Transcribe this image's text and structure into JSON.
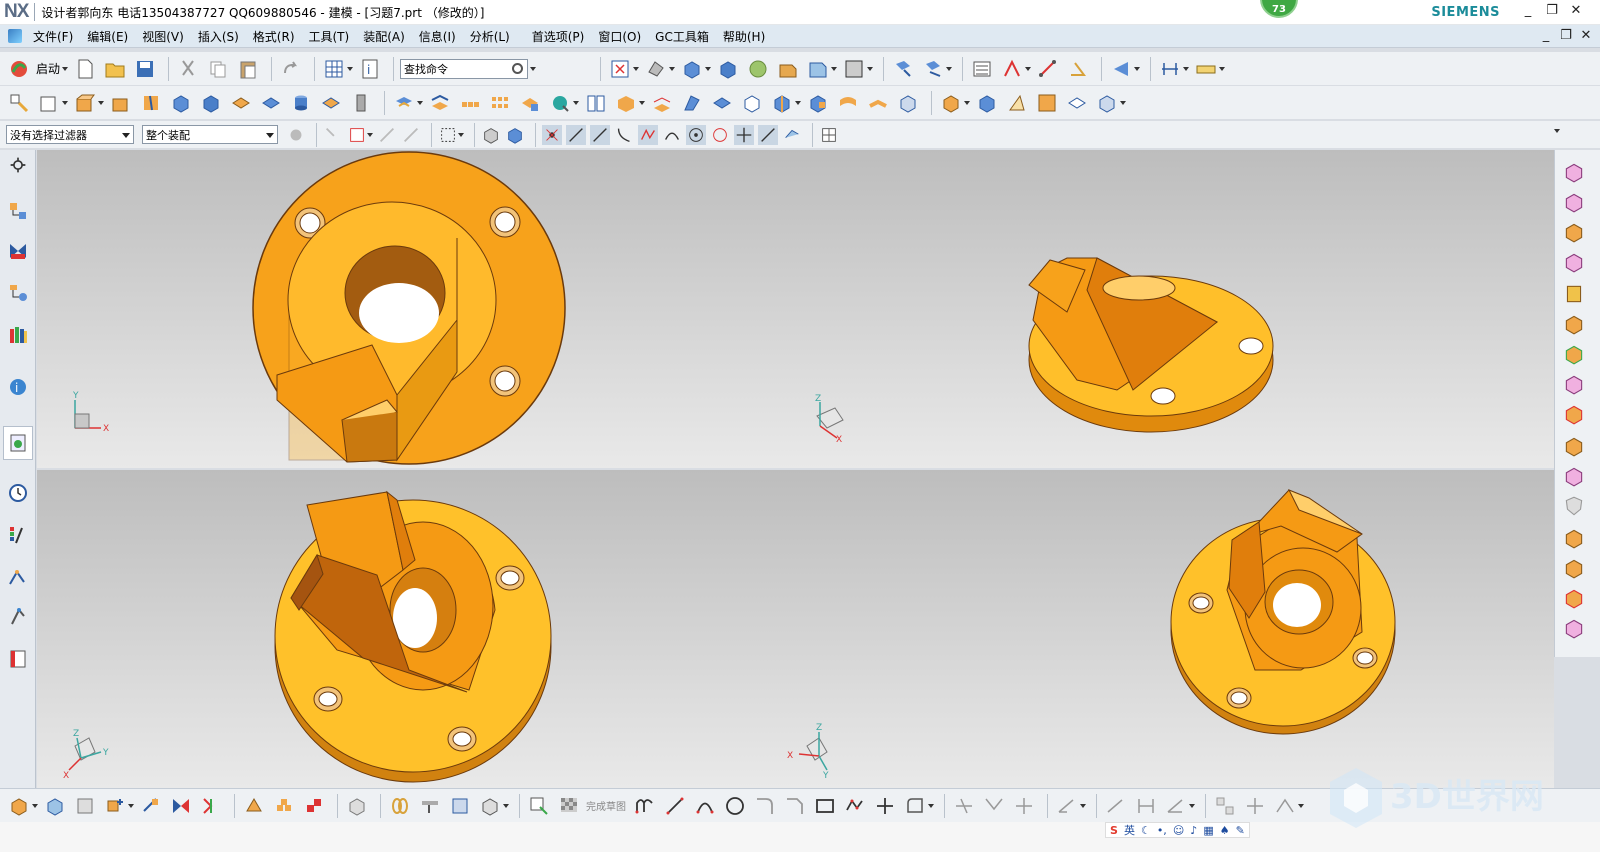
{
  "titlebar": {
    "logo": "NX",
    "title": "设计者郭向东  电话13504387727  QQ609880546 - 建模 - [习题7.prt （修改的）]",
    "brand": "SIEMENS",
    "badge": "73",
    "minimize": "_",
    "restore": "❐",
    "close": "✕"
  },
  "menubar": {
    "items": [
      "文件(F)",
      "编辑(E)",
      "视图(V)",
      "插入(S)",
      "格式(R)",
      "工具(T)",
      "装配(A)",
      "信息(I)",
      "分析(L)",
      "首选项(P)",
      "窗口(O)",
      "GC工具箱",
      "帮助(H)"
    ]
  },
  "toolbar1": {
    "start_label": "启动",
    "search_placeholder": "查找命令"
  },
  "selectionbar": {
    "filter_value": "没有选择过滤器",
    "scope_value": "整个装配"
  },
  "sketchbar": {
    "finish_sketch_label": "完成草图"
  },
  "ime": {
    "s": "S",
    "lang": "英"
  },
  "watermark": {
    "text": "3D世界网"
  },
  "viewport": {
    "part_color": "#f5a623",
    "part_dark": "#c9781a",
    "part_light": "#ffc43a",
    "axes": {
      "x": "X",
      "y": "Y",
      "z": "Z"
    }
  }
}
